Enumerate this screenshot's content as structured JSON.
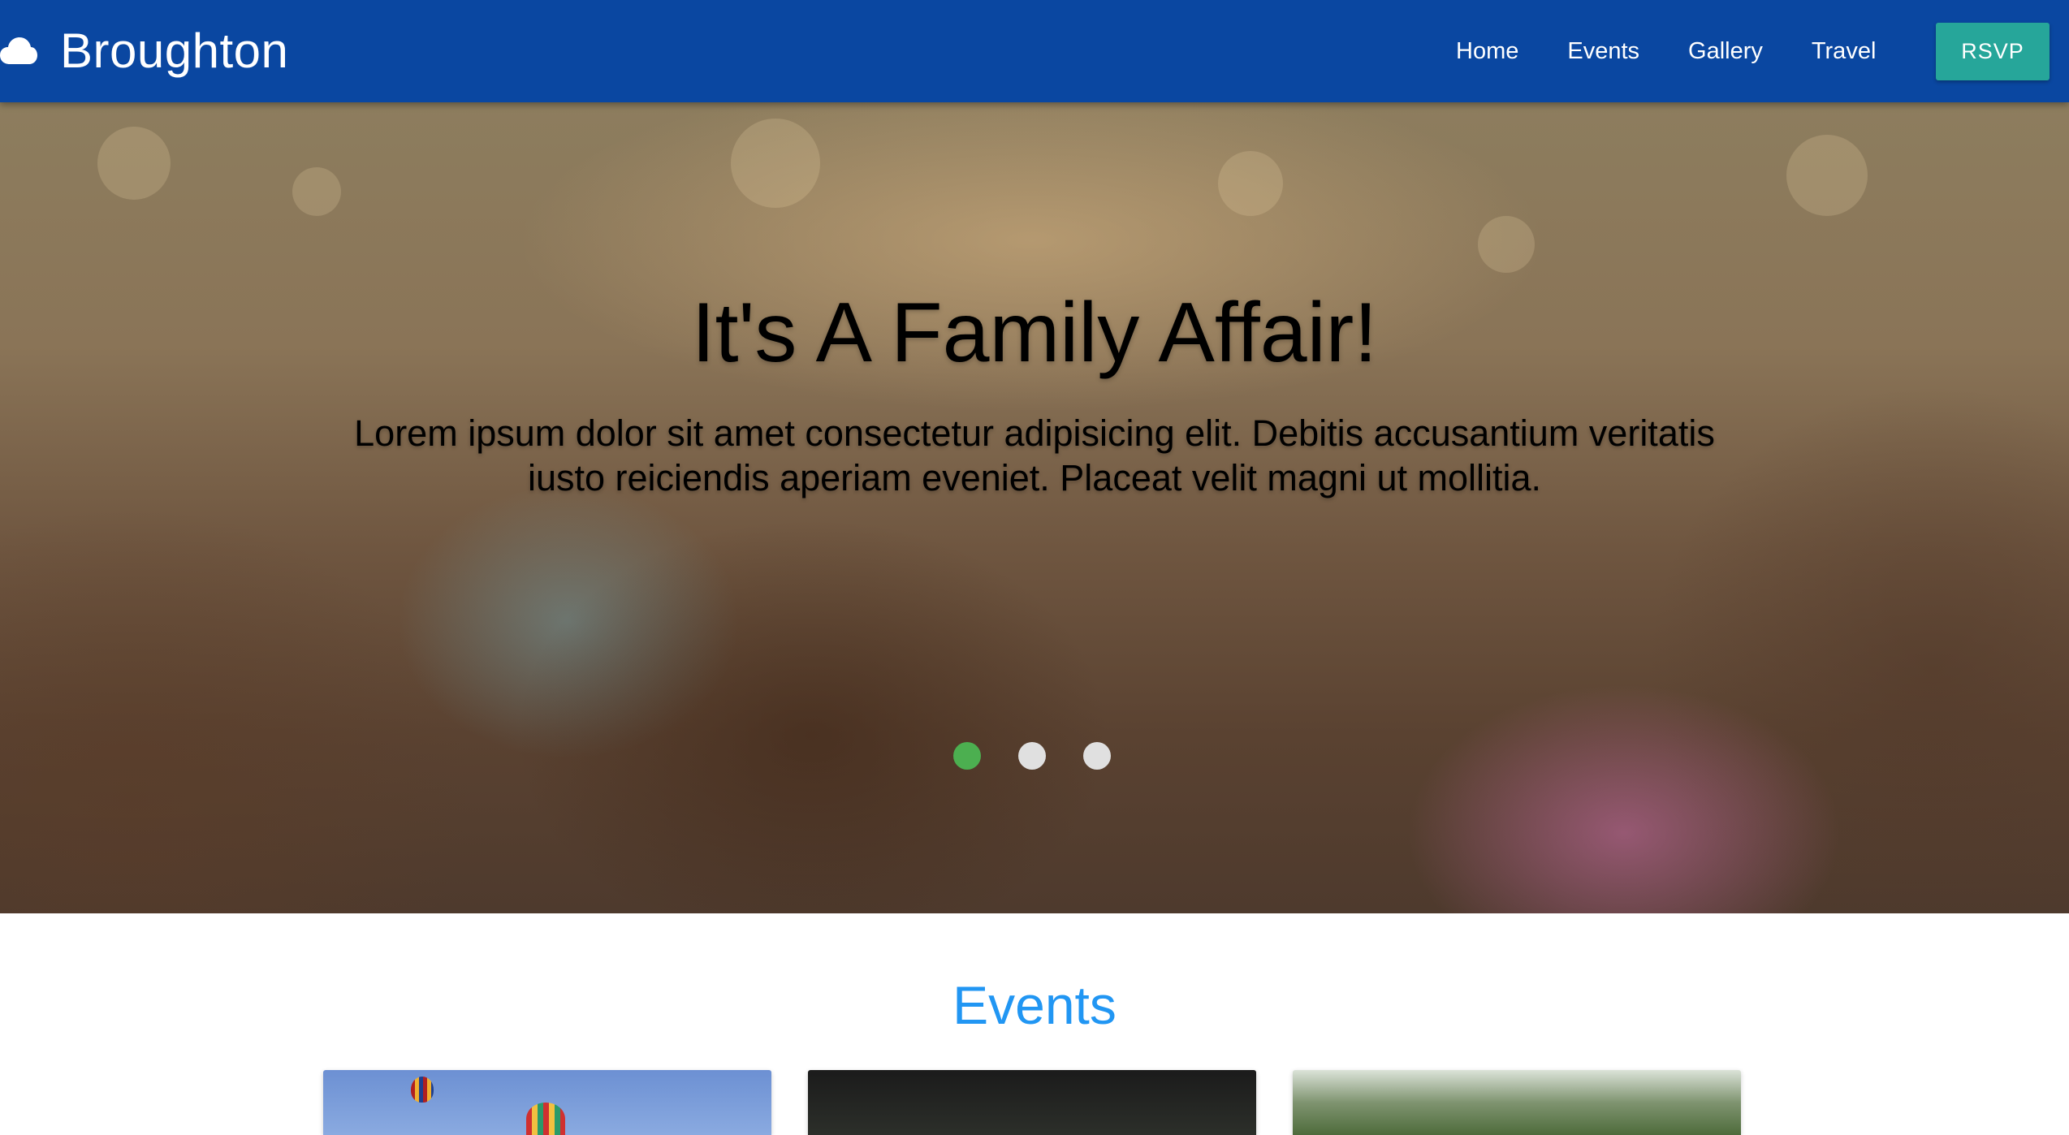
{
  "navbar": {
    "brand": "Broughton",
    "brand_icon": "cloud-icon",
    "background_color": "#0a47a1",
    "links": [
      "Home",
      "Events",
      "Gallery",
      "Travel"
    ],
    "rsvp_label": "RSVP",
    "rsvp_color": "#26a69a"
  },
  "hero": {
    "title": "It's A Family Affair!",
    "subtitle": "Lorem ipsum dolor sit amet consectetur adipisicing elit. Debitis accusantium veritatis iusto reiciendis aperiam eveniet. Placeat velit magni ut mollitia.",
    "indicator_count": 3,
    "active_indicator": 1,
    "active_indicator_color": "#4caf50"
  },
  "events": {
    "title": "Events",
    "title_color": "#2196f3",
    "card_count": 3
  }
}
